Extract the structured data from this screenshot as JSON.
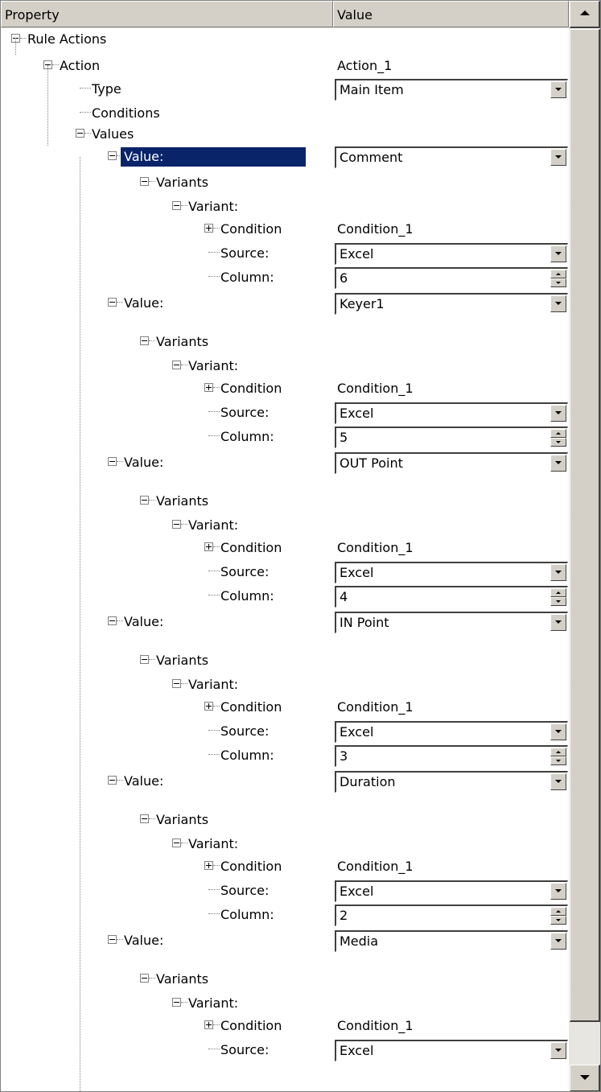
{
  "header": {
    "property_label": "Property",
    "value_label": "Value"
  },
  "rows": [
    {
      "label": "Rule Actions",
      "value": ""
    },
    {
      "label": "Action",
      "value": "Action_1"
    },
    {
      "label": "Type",
      "value": "Main Item",
      "control": "dropdown"
    },
    {
      "label": "Conditions",
      "value": ""
    },
    {
      "label": "Values",
      "value": ""
    },
    {
      "label": "Value:",
      "value": "Comment",
      "control": "dropdown",
      "selected": true
    },
    {
      "label": "Variants",
      "value": ""
    },
    {
      "label": "Variant:",
      "value": ""
    },
    {
      "label": "Condition",
      "value": "Condition_1"
    },
    {
      "label": "Source:",
      "value": "Excel",
      "control": "dropdown"
    },
    {
      "label": "Column:",
      "value": "6",
      "control": "spinner"
    },
    {
      "label": "Value:",
      "value": "Keyer1",
      "control": "dropdown"
    },
    {
      "label": "Variants",
      "value": ""
    },
    {
      "label": "Variant:",
      "value": ""
    },
    {
      "label": "Condition",
      "value": "Condition_1"
    },
    {
      "label": "Source:",
      "value": "Excel",
      "control": "dropdown"
    },
    {
      "label": "Column:",
      "value": "5",
      "control": "spinner"
    },
    {
      "label": "Value:",
      "value": "OUT Point",
      "control": "dropdown"
    },
    {
      "label": "Variants",
      "value": ""
    },
    {
      "label": "Variant:",
      "value": ""
    },
    {
      "label": "Condition",
      "value": "Condition_1"
    },
    {
      "label": "Source:",
      "value": "Excel",
      "control": "dropdown"
    },
    {
      "label": "Column:",
      "value": "4",
      "control": "spinner"
    },
    {
      "label": "Value:",
      "value": "IN Point",
      "control": "dropdown"
    },
    {
      "label": "Variants",
      "value": ""
    },
    {
      "label": "Variant:",
      "value": ""
    },
    {
      "label": "Condition",
      "value": "Condition_1"
    },
    {
      "label": "Source:",
      "value": "Excel",
      "control": "dropdown"
    },
    {
      "label": "Column:",
      "value": "3",
      "control": "spinner"
    },
    {
      "label": "Value:",
      "value": "Duration",
      "control": "dropdown"
    },
    {
      "label": "Variants",
      "value": ""
    },
    {
      "label": "Variant:",
      "value": ""
    },
    {
      "label": "Condition",
      "value": "Condition_1"
    },
    {
      "label": "Source:",
      "value": "Excel",
      "control": "dropdown"
    },
    {
      "label": "Column:",
      "value": "2",
      "control": "spinner"
    },
    {
      "label": "Value:",
      "value": "Media",
      "control": "dropdown"
    },
    {
      "label": "Variants",
      "value": ""
    },
    {
      "label": "Variant:",
      "value": ""
    },
    {
      "label": "Condition",
      "value": "Condition_1"
    },
    {
      "label": "Source:",
      "value": "Excel",
      "control": "dropdown"
    }
  ]
}
